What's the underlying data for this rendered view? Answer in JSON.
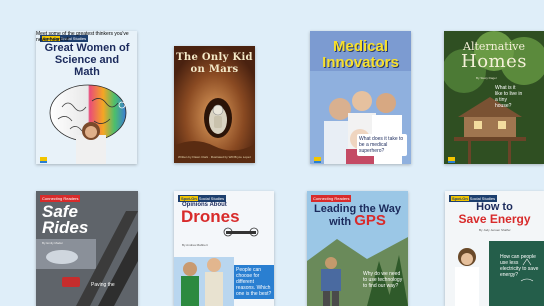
{
  "books": [
    {
      "series": "Social Studies",
      "title": "Great Women of Science and Math",
      "author": "By Lisa Hicks",
      "blurb": "Meet some of the greatest thinkers you've never heard of!"
    },
    {
      "title": "The Only Kid on Mars",
      "author": "Written by Flawn Clark  ·  Illustrated by Will Bryce Lopez"
    },
    {
      "title": "Medical Innovators",
      "blurb": "What does it take to be a medical superhero?"
    },
    {
      "title_line1": "Alternative",
      "title_line2": "Homes",
      "author": "By Stacy Dagel",
      "blurb": "What is it like to live in a tiny house?"
    },
    {
      "series": "Connecting Readers",
      "title": "Safe Rides",
      "author": "By Emily Mader",
      "blurb": "Paving the"
    },
    {
      "series": "Social Studies",
      "subtitle": "Opinions About",
      "title": "Drones",
      "author": "By Andrea Mabbert",
      "blurb": "People can choose for different reasons. Which one is the best?"
    },
    {
      "series": "Connecting Readers",
      "title_line1": "Leading the Way",
      "title_line2": "with",
      "title_gps": "GPS",
      "blurb": "Why do we need to use technology to find our way?"
    },
    {
      "series": "Social Studies",
      "title_line1": "How to",
      "title_line2": "Save Energy",
      "author": "By Jody Jensen Shaffer",
      "blurb": "How can people use less electricity to save energy?"
    }
  ]
}
